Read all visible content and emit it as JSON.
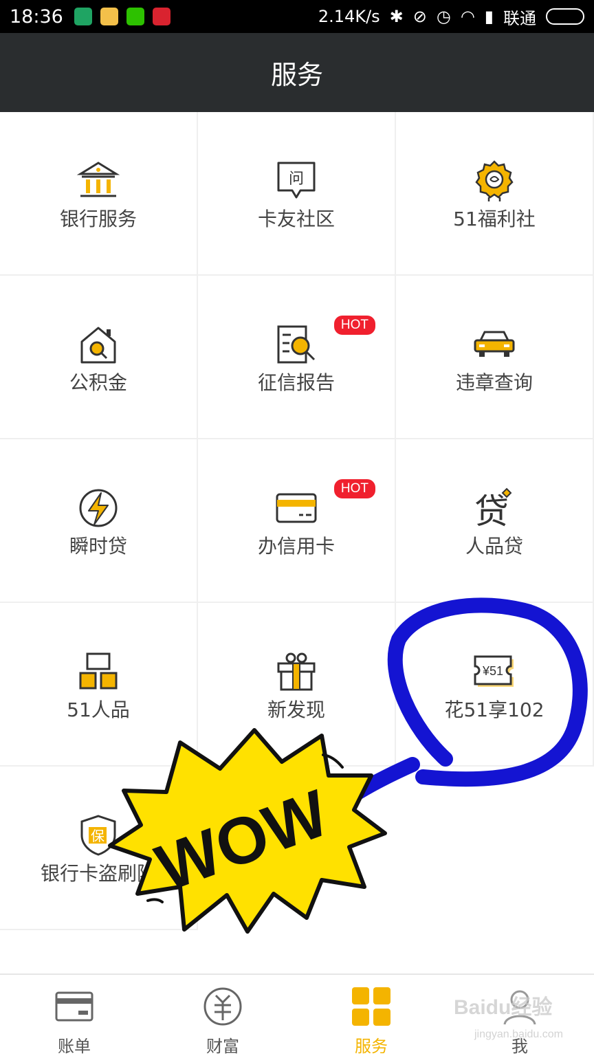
{
  "status_bar": {
    "time": "18:36",
    "net_speed": "2.14K/s",
    "carrier": "联通"
  },
  "header": {
    "title": "服务"
  },
  "services": [
    {
      "label": "银行服务",
      "icon": "bank-icon"
    },
    {
      "label": "卡友社区",
      "icon": "question-bubble-icon",
      "glyph": "问"
    },
    {
      "label": "51福利社",
      "icon": "welfare-badge-icon"
    },
    {
      "label": "公积金",
      "icon": "house-search-icon"
    },
    {
      "label": "征信报告",
      "icon": "report-search-icon",
      "badge": "HOT"
    },
    {
      "label": "违章查询",
      "icon": "car-icon"
    },
    {
      "label": "瞬时贷",
      "icon": "lightning-icon"
    },
    {
      "label": "办信用卡",
      "icon": "credit-card-icon",
      "badge": "HOT"
    },
    {
      "label": "人品贷",
      "icon": "loan-character-icon",
      "glyph": "贷"
    },
    {
      "label": "51人品",
      "icon": "blocks-icon"
    },
    {
      "label": "新发现",
      "icon": "gift-icon"
    },
    {
      "label": "花51享102",
      "icon": "coupon-icon",
      "glyph": "¥51"
    },
    {
      "label": "银行卡盗刷险",
      "icon": "shield-insurance-icon",
      "glyph": "保"
    }
  ],
  "bottom_nav": [
    {
      "label": "账单",
      "icon": "bill-card-icon",
      "active": false
    },
    {
      "label": "财富",
      "icon": "wealth-coin-icon",
      "active": false
    },
    {
      "label": "服务",
      "icon": "service-grid-icon",
      "active": true
    },
    {
      "label": "我",
      "icon": "profile-icon",
      "active": false
    }
  ],
  "annotations": {
    "sticker_text": "WOW"
  },
  "watermark": {
    "text": "Baidu经验",
    "url": "jingyan.baidu.com"
  },
  "colors": {
    "accent": "#F4B400",
    "header_bg": "#2A2D2F",
    "hot_badge": "#F0202E",
    "annotation_blue": "#1414D2",
    "sticker_yellow": "#FFE100"
  }
}
